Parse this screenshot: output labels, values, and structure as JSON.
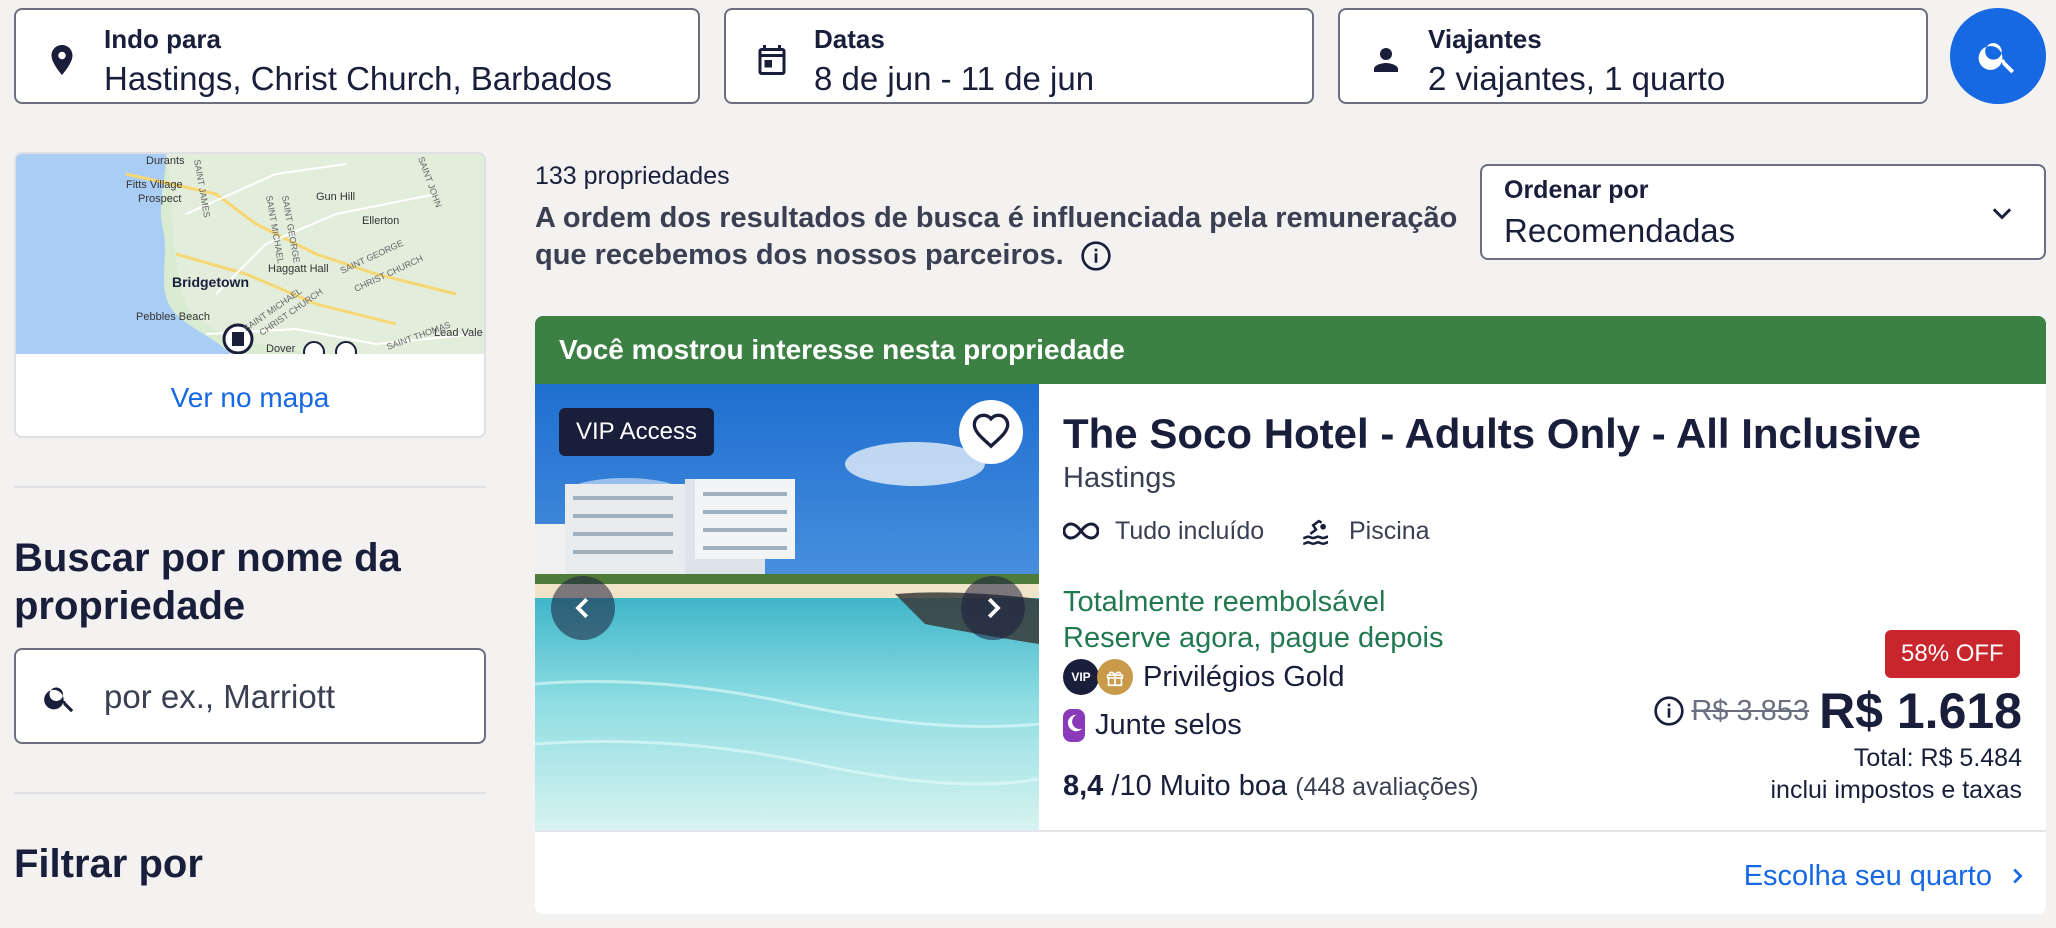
{
  "search": {
    "destination": {
      "label": "Indo para",
      "value": "Hastings, Christ Church, Barbados",
      "icon": "location-pin-icon"
    },
    "dates": {
      "label": "Datas",
      "value": "8 de jun - 11 de jun",
      "icon": "calendar-icon"
    },
    "travelers": {
      "label": "Viajantes",
      "value": "2 viajantes, 1 quarto",
      "icon": "person-icon"
    },
    "button_icon": "search-icon"
  },
  "map": {
    "link": "Ver no mapa",
    "labels": [
      "Durants",
      "Fitts Village",
      "Prospect",
      "Gun Hill",
      "Ellerton",
      "Haggatt Hall",
      "Bridgetown",
      "Pebbles Beach",
      "Lead Vale",
      "Dover",
      "SAINT GEORGE",
      "SAINT MICHAEL",
      "SAINT JAMES",
      "SAINT JOHN",
      "CHRIST CHURCH",
      "SAINT GEORGE",
      "SAINT MICHAEL",
      "CHRIST CHURCH",
      "SAINT THOMAS"
    ]
  },
  "sidebar": {
    "name_search_title": "Buscar por nome da propriedade",
    "name_search_placeholder": "por ex., Marriott",
    "filter_title": "Filtrar por"
  },
  "results": {
    "count": "133 propriedades",
    "disclaimer": "A ordem dos resultados de busca é influenciada pela remuneração que recebemos dos nossos parceiros.",
    "sort": {
      "label": "Ordenar por",
      "value": "Recomendadas"
    }
  },
  "property": {
    "banner": "Você mostrou interesse nesta propriedade",
    "vip_badge": "VIP Access",
    "name": "The Soco Hotel - Adults Only - All Inclusive",
    "location": "Hastings",
    "amenities": [
      {
        "label": "Tudo incluído",
        "icon": "infinity-icon"
      },
      {
        "label": "Piscina",
        "icon": "pool-icon"
      }
    ],
    "refundable": "Totalmente reembolsável",
    "pay_later": "Reserve agora, pague depois",
    "privileges": "Privilégios Gold",
    "privileges_vip": "VIP",
    "stamps": "Junte selos",
    "rating_score": "8,4",
    "rating_scale": "/10 Muito boa",
    "rating_reviews": "(448 avaliações)",
    "discount": "58% OFF",
    "old_price": "R$ 3.853",
    "price": "R$ 1.618",
    "total": "Total: R$ 5.484",
    "taxes": "inclui impostos e taxas",
    "cta": "Escolha seu quarto"
  },
  "colors": {
    "primary": "#1668e3",
    "banner_green": "#3c8044",
    "refund_green": "#227950",
    "discount_red": "#c9252c",
    "text_dark": "#191e3b"
  }
}
